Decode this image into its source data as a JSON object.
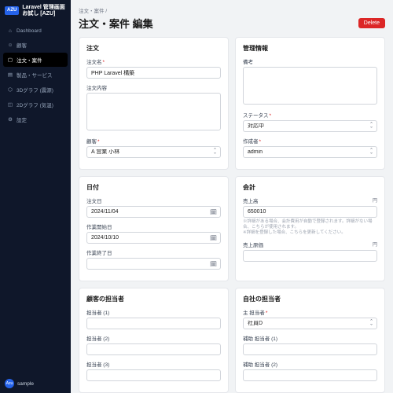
{
  "brand": {
    "logo": "AZU",
    "title": "Laravel 管理画面\nお試し [AZU]"
  },
  "nav": [
    {
      "icon": "⌂",
      "label": "Dashboard"
    },
    {
      "icon": "☺",
      "label": "顧客"
    },
    {
      "icon": "▢",
      "label": "注文・案件"
    },
    {
      "icon": "▤",
      "label": "製品・サービス"
    },
    {
      "icon": "⬡",
      "label": "3Dグラフ (震源)"
    },
    {
      "icon": "◫",
      "label": "2Dグラフ (気温)"
    },
    {
      "icon": "⚙",
      "label": "設定"
    }
  ],
  "user": {
    "name": "sample",
    "avatar": "Azu"
  },
  "breadcrumb": "注文・案件  /",
  "page_title": "注文・案件 編集",
  "delete_label": "Delete",
  "cards": {
    "order": {
      "title": "注文",
      "name_label": "注文名",
      "name_value": "PHP Laravel 構築",
      "content_label": "注文内容",
      "content_value": "",
      "customer_label": "顧客",
      "customer_value": "A 営業 小林"
    },
    "mgmt": {
      "title": "管理情報",
      "note_label": "備考",
      "note_value": "",
      "status_label": "ステータス",
      "status_value": "対応中",
      "creator_label": "作成者",
      "creator_value": "admin"
    },
    "dates": {
      "title": "日付",
      "order_date_label": "注文日",
      "order_date_value": "2024/11/04",
      "start_label": "作業開始日",
      "start_value": "2024/10/10",
      "end_label": "作業終了日",
      "end_value": ""
    },
    "acc": {
      "title": "会計",
      "sales_label": "売上高",
      "sales_value": "650010",
      "unit": "円",
      "hint": "※詳細がある場合、会計費用が自動で登録されます。詳細がない場合、こちらが使用されます。\n※詳細を登録した場合、こちらを更新してください。",
      "cost_label": "売上原価",
      "cost_value": ""
    },
    "cust_pic": {
      "title": "顧客の担当者",
      "p1": "担当者 (1)",
      "p2": "担当者 (2)",
      "p3": "担当者 (3)"
    },
    "own_pic": {
      "title": "自社の担当者",
      "main_label": "主 担当者",
      "main_value": "社員D",
      "sub1": "補助 担当者 (1)",
      "sub2": "補助 担当者 (2)"
    }
  }
}
